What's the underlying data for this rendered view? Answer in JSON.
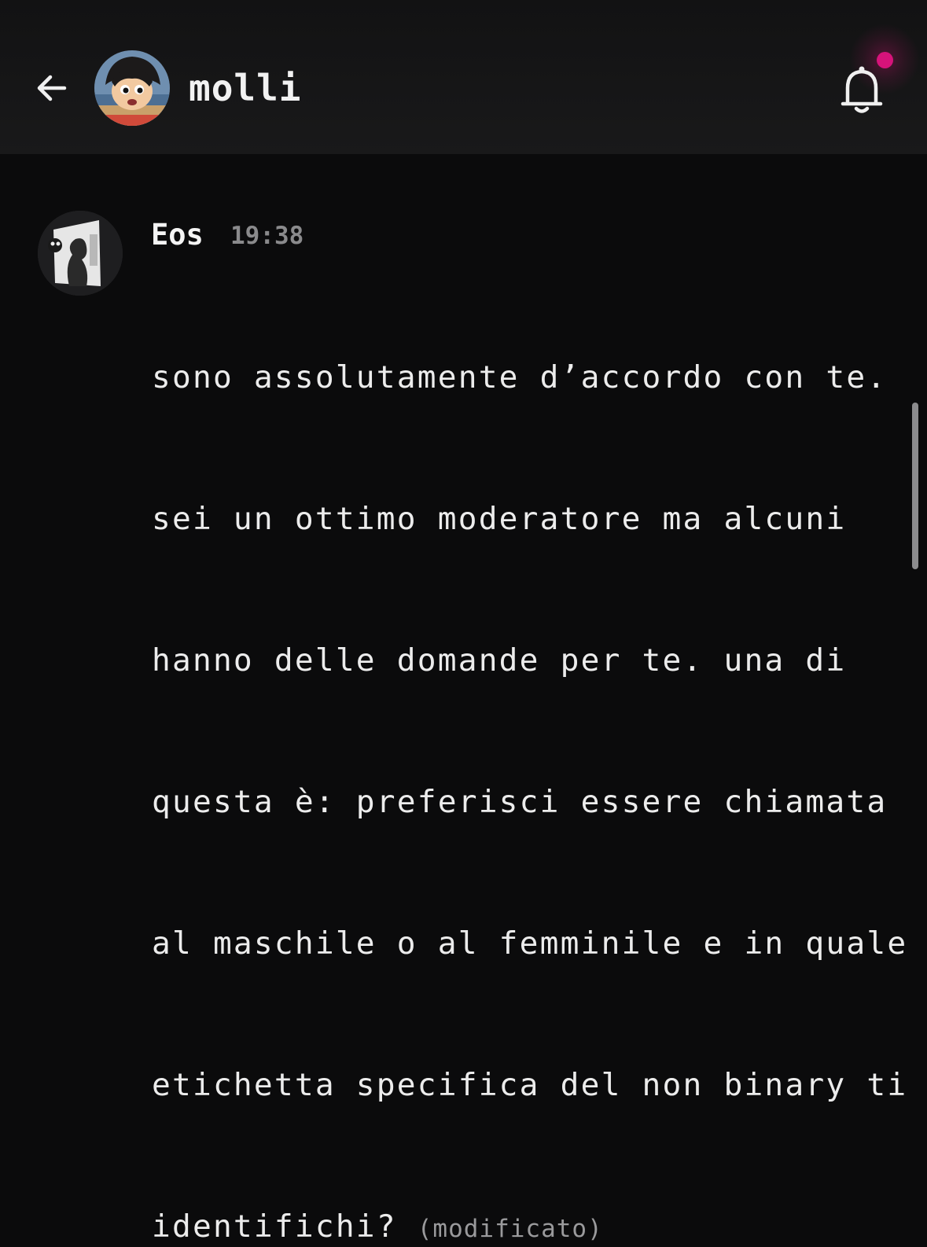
{
  "header": {
    "title": "molli",
    "back_icon": "arrow-left-icon",
    "notification_icon": "bell-icon",
    "notification_dot_color": "#d6137a"
  },
  "message": {
    "author": "Eos",
    "time": "19:38",
    "lines": [
      "sono assolutamente d’accordo con te.",
      "sei un ottimo moderatore ma alcuni",
      "hanno delle domande per te. una di",
      "questa è: preferisci essere chiamata",
      "al maschile o al femminile e in quale",
      "etichetta specifica del non binary ti",
      "identifichi?"
    ],
    "edited_label": "(modificato)"
  }
}
